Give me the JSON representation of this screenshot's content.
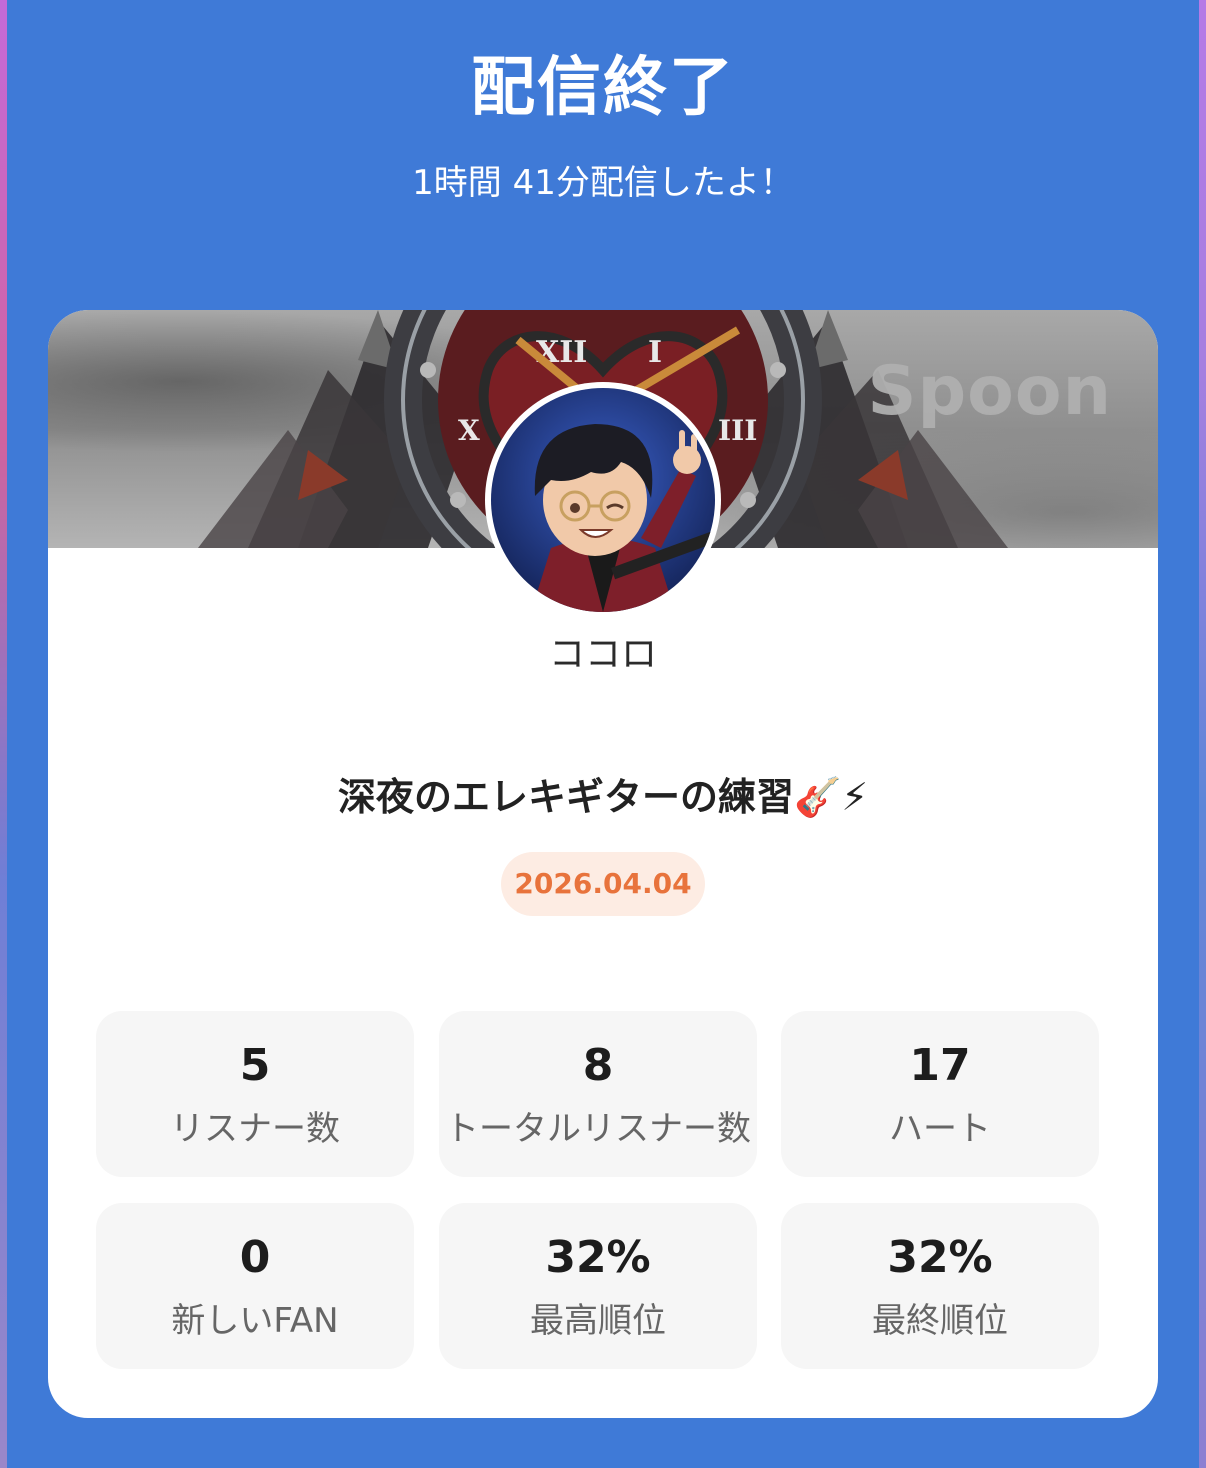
{
  "header": {
    "title": "配信終了",
    "subtitle": "1時間 41分配信したよ！"
  },
  "card": {
    "banner_logo": "Spoon",
    "avatar_icon": "user-avatar-icon",
    "username": "ココロ",
    "stream_title": "深夜のエレキギターの練習",
    "stream_title_emoji": "🎸⚡",
    "date": "2026.04.04"
  },
  "stats": [
    {
      "value": "5",
      "label": "リスナー数"
    },
    {
      "value": "8",
      "label": "トータルリスナー数"
    },
    {
      "value": "17",
      "label": "ハート"
    },
    {
      "value": "0",
      "label": "新しいFAN"
    },
    {
      "value": "32%",
      "label": "最高順位"
    },
    {
      "value": "32%",
      "label": "最終順位"
    }
  ],
  "colors": {
    "background": "#3f7ad7",
    "card": "#ffffff",
    "date_text": "#e8733c",
    "date_bg": "#fdece3",
    "stat_bg": "#f6f6f6"
  }
}
